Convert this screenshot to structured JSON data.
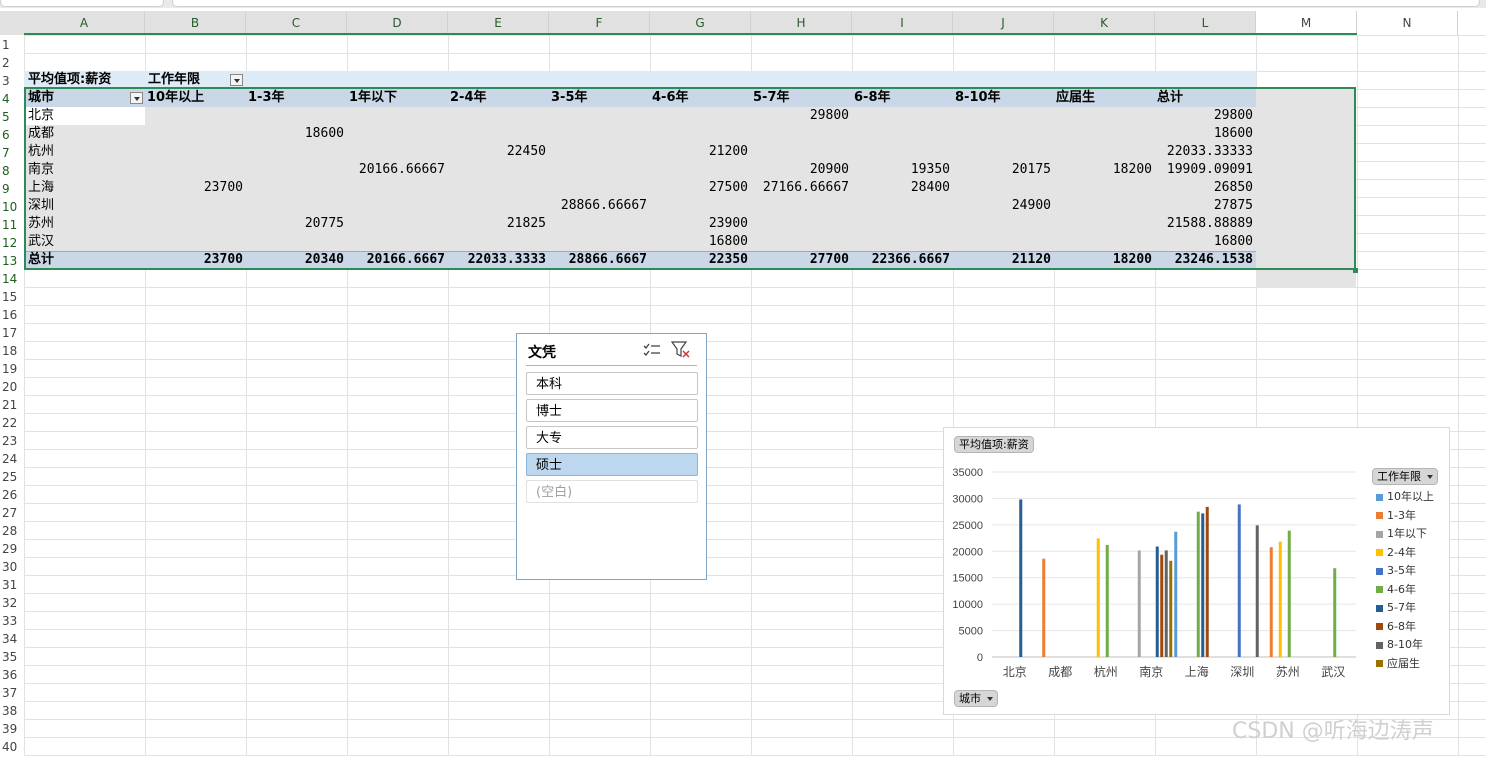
{
  "columns": [
    "A",
    "B",
    "C",
    "D",
    "E",
    "F",
    "G",
    "H",
    "I",
    "J",
    "K",
    "L",
    "M",
    "N"
  ],
  "rows": [
    "1",
    "2",
    "3",
    "4",
    "5",
    "6",
    "7",
    "8",
    "9",
    "10",
    "11",
    "12",
    "13",
    "14",
    "15",
    "16",
    "17",
    "18",
    "19",
    "20",
    "21",
    "22",
    "23",
    "24",
    "25",
    "26",
    "27",
    "28",
    "29",
    "30",
    "31",
    "32",
    "33",
    "34",
    "35",
    "36",
    "37",
    "38",
    "39",
    "40"
  ],
  "pivot": {
    "value_label": "平均值项:薪资",
    "col_field": "工作年限",
    "row_field": "城市",
    "col_headers": [
      "10年以上",
      "1-3年",
      "1年以下",
      "2-4年",
      "3-5年",
      "4-6年",
      "5-7年",
      "6-8年",
      "8-10年",
      "应届生",
      "总计"
    ],
    "rows": [
      {
        "city": "北京",
        "values": [
          "",
          "",
          "",
          "",
          "",
          "",
          "29800",
          "",
          "",
          "",
          "29800"
        ]
      },
      {
        "city": "成都",
        "values": [
          "",
          "18600",
          "",
          "",
          "",
          "",
          "",
          "",
          "",
          "",
          "18600"
        ]
      },
      {
        "city": "杭州",
        "values": [
          "",
          "",
          "",
          "22450",
          "",
          "21200",
          "",
          "",
          "",
          "",
          "22033.33333"
        ]
      },
      {
        "city": "南京",
        "values": [
          "",
          "",
          "20166.66667",
          "",
          "",
          "",
          "20900",
          "19350",
          "20175",
          "18200",
          "19909.09091"
        ]
      },
      {
        "city": "上海",
        "values": [
          "23700",
          "",
          "",
          "",
          "",
          "27500",
          "27166.66667",
          "28400",
          "",
          "",
          "26850"
        ]
      },
      {
        "city": "深圳",
        "values": [
          "",
          "",
          "",
          "",
          "28866.66667",
          "",
          "",
          "",
          "24900",
          "",
          "27875"
        ]
      },
      {
        "city": "苏州",
        "values": [
          "",
          "20775",
          "",
          "21825",
          "",
          "23900",
          "",
          "",
          "",
          "",
          "21588.88889"
        ]
      },
      {
        "city": "武汉",
        "values": [
          "",
          "",
          "",
          "",
          "",
          "16800",
          "",
          "",
          "",
          "",
          "16800"
        ]
      }
    ],
    "total_label": "总计",
    "totals": [
      "23700",
      "20340",
      "20166.6667",
      "22033.3333",
      "28866.6667",
      "22350",
      "27700",
      "22366.6667",
      "21120",
      "18200",
      "23246.1538"
    ]
  },
  "slicer": {
    "title": "文凭",
    "items": [
      {
        "label": "本科",
        "selected": false,
        "empty": false
      },
      {
        "label": "博士",
        "selected": false,
        "empty": false
      },
      {
        "label": "大专",
        "selected": false,
        "empty": false
      },
      {
        "label": "硕士",
        "selected": true,
        "empty": false
      },
      {
        "label": "(空白)",
        "selected": false,
        "empty": true
      }
    ],
    "icons": [
      "multi-select-icon",
      "clear-filter-icon"
    ]
  },
  "chart_chips": {
    "value_field": "平均值项:薪资",
    "legend_field": "工作年限",
    "axis_field": "城市"
  },
  "chart_data": {
    "type": "bar",
    "categories": [
      "北京",
      "成都",
      "杭州",
      "南京",
      "上海",
      "深圳",
      "苏州",
      "武汉"
    ],
    "ylim": [
      0,
      35000
    ],
    "yticks": [
      0,
      5000,
      10000,
      15000,
      20000,
      25000,
      30000,
      35000
    ],
    "grid": true,
    "legend_position": "right",
    "series": [
      {
        "name": "10年以上",
        "color": "#5b9bd5",
        "values": [
          null,
          null,
          null,
          null,
          23700,
          null,
          null,
          null
        ]
      },
      {
        "name": "1-3年",
        "color": "#ed7d31",
        "values": [
          null,
          18600,
          null,
          null,
          null,
          null,
          20775,
          null
        ]
      },
      {
        "name": "1年以下",
        "color": "#a5a5a5",
        "values": [
          null,
          null,
          null,
          20166.67,
          null,
          null,
          null,
          null
        ]
      },
      {
        "name": "2-4年",
        "color": "#ffc000",
        "values": [
          null,
          null,
          22450,
          null,
          null,
          null,
          21825,
          null
        ]
      },
      {
        "name": "3-5年",
        "color": "#4472c4",
        "values": [
          null,
          null,
          null,
          null,
          null,
          28866.67,
          null,
          null
        ]
      },
      {
        "name": "4-6年",
        "color": "#70ad47",
        "values": [
          null,
          null,
          21200,
          null,
          27500,
          null,
          23900,
          16800
        ]
      },
      {
        "name": "5-7年",
        "color": "#255e91",
        "values": [
          29800,
          null,
          null,
          20900,
          27166.67,
          null,
          null,
          null
        ]
      },
      {
        "name": "6-8年",
        "color": "#9e480e",
        "values": [
          null,
          null,
          null,
          19350,
          28400,
          null,
          null,
          null
        ]
      },
      {
        "name": "8-10年",
        "color": "#636363",
        "values": [
          null,
          null,
          null,
          20175,
          null,
          24900,
          null,
          null
        ]
      },
      {
        "name": "应届生",
        "color": "#997300",
        "values": [
          null,
          null,
          null,
          18200,
          null,
          null,
          null,
          null
        ]
      }
    ]
  },
  "watermark": "CSDN @听海边涛声"
}
